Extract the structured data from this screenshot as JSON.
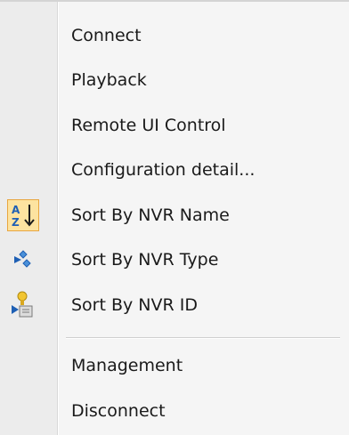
{
  "menu": {
    "items": [
      {
        "label": "Connect"
      },
      {
        "label": "Playback"
      },
      {
        "label": "Remote UI Control"
      },
      {
        "label": "Configuration detail..."
      },
      {
        "label": "Sort By NVR Name",
        "icon": "sort-az-icon",
        "checked": true
      },
      {
        "label": "Sort By NVR Type",
        "icon": "sort-type-icon"
      },
      {
        "label": "Sort By NVR ID",
        "icon": "sort-id-icon"
      },
      {
        "label": "Management"
      },
      {
        "label": "Disconnect"
      }
    ]
  },
  "colors": {
    "checked_bg": "#fde3a0",
    "checked_border": "#e8a640",
    "arrow_blue": "#1e5fb4"
  }
}
